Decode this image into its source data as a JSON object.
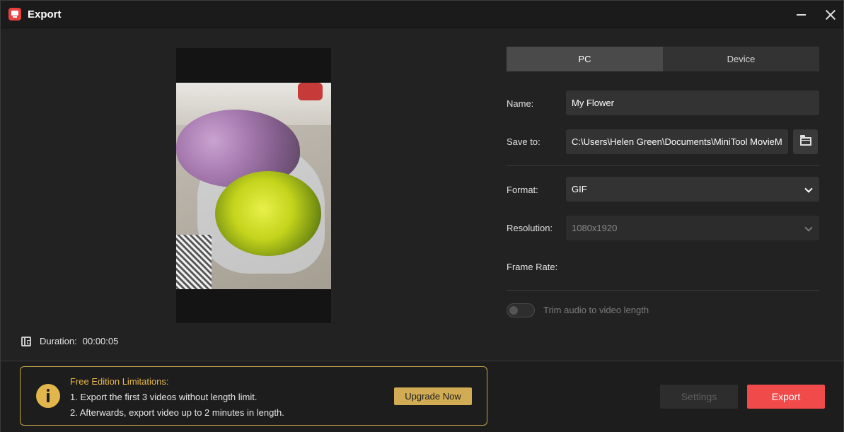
{
  "window": {
    "title": "Export",
    "icons": {
      "app": "app-logo-icon",
      "minimize": "minimize-icon",
      "close": "close-icon"
    }
  },
  "preview": {
    "image": "flower-bouquet-photo",
    "duration_label": "Duration:",
    "duration_value": "00:00:05"
  },
  "tabs": [
    {
      "label": "PC",
      "active": true
    },
    {
      "label": "Device",
      "active": false
    }
  ],
  "form": {
    "name_label": "Name:",
    "name_value": "My Flower",
    "save_to_label": "Save to:",
    "save_to_value": "C:\\Users\\Helen Green\\Documents\\MiniTool MovieM",
    "format_label": "Format:",
    "format_value": "GIF",
    "resolution_label": "Resolution:",
    "resolution_value": "1080x1920",
    "frame_rate_label": "Frame Rate:",
    "trim_audio_label": "Trim audio to video length",
    "trim_audio_on": false
  },
  "notice": {
    "title": "Free Edition Limitations:",
    "line1": "1. Export the first 3 videos without length limit.",
    "line2": "2. Afterwards, export video up to 2 minutes in length.",
    "upgrade_label": "Upgrade Now"
  },
  "actions": {
    "settings_label": "Settings",
    "export_label": "Export"
  },
  "colors": {
    "accent_export": "#f04a4a",
    "notice_gold": "#d2ac55",
    "background": "#222222"
  }
}
